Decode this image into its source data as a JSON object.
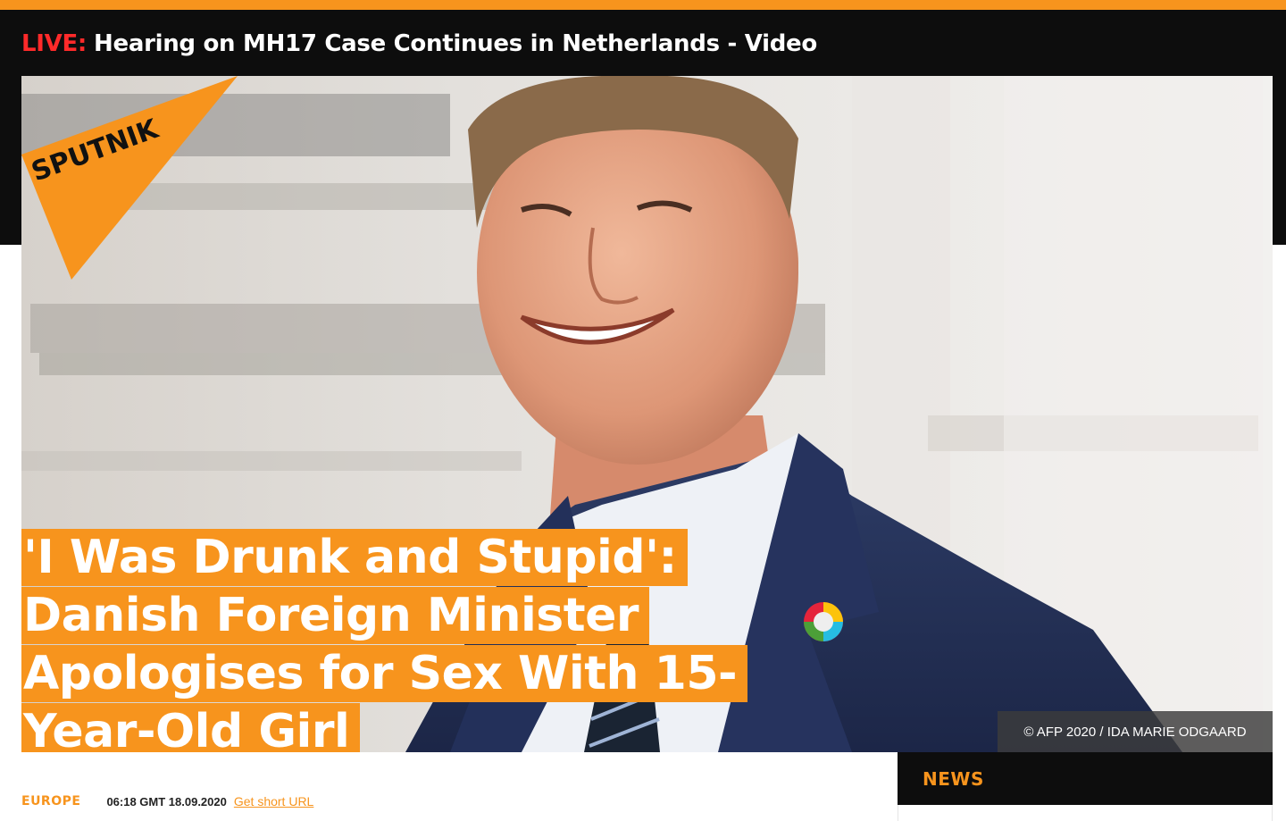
{
  "live_bar": {
    "live_label": "LIVE:",
    "text": "Hearing on MH17 Case Continues in Netherlands - Video"
  },
  "brand": {
    "logo_text": "SPUTNIK",
    "accent_color": "#f7941d",
    "live_color": "#ff2a2a",
    "dark_color": "#0d0d0d"
  },
  "article": {
    "headline_lines": [
      "'I Was Drunk and Stupid':",
      "Danish Foreign Minister",
      "Apologises for Sex With 15-",
      "Year-Old Girl"
    ],
    "photo_credit": "© AFP 2020 / IDA MARIE ODGAARD",
    "category": "EUROPE",
    "datetime": "06:18 GMT 18.09.2020",
    "short_url_label": "Get short URL"
  },
  "sidebar": {
    "news_title": "NEWS"
  },
  "icons": {
    "photo": "hero-photo",
    "logo": "sputnik-logo-icon",
    "pin": "sdg-lapel-pin-icon"
  }
}
